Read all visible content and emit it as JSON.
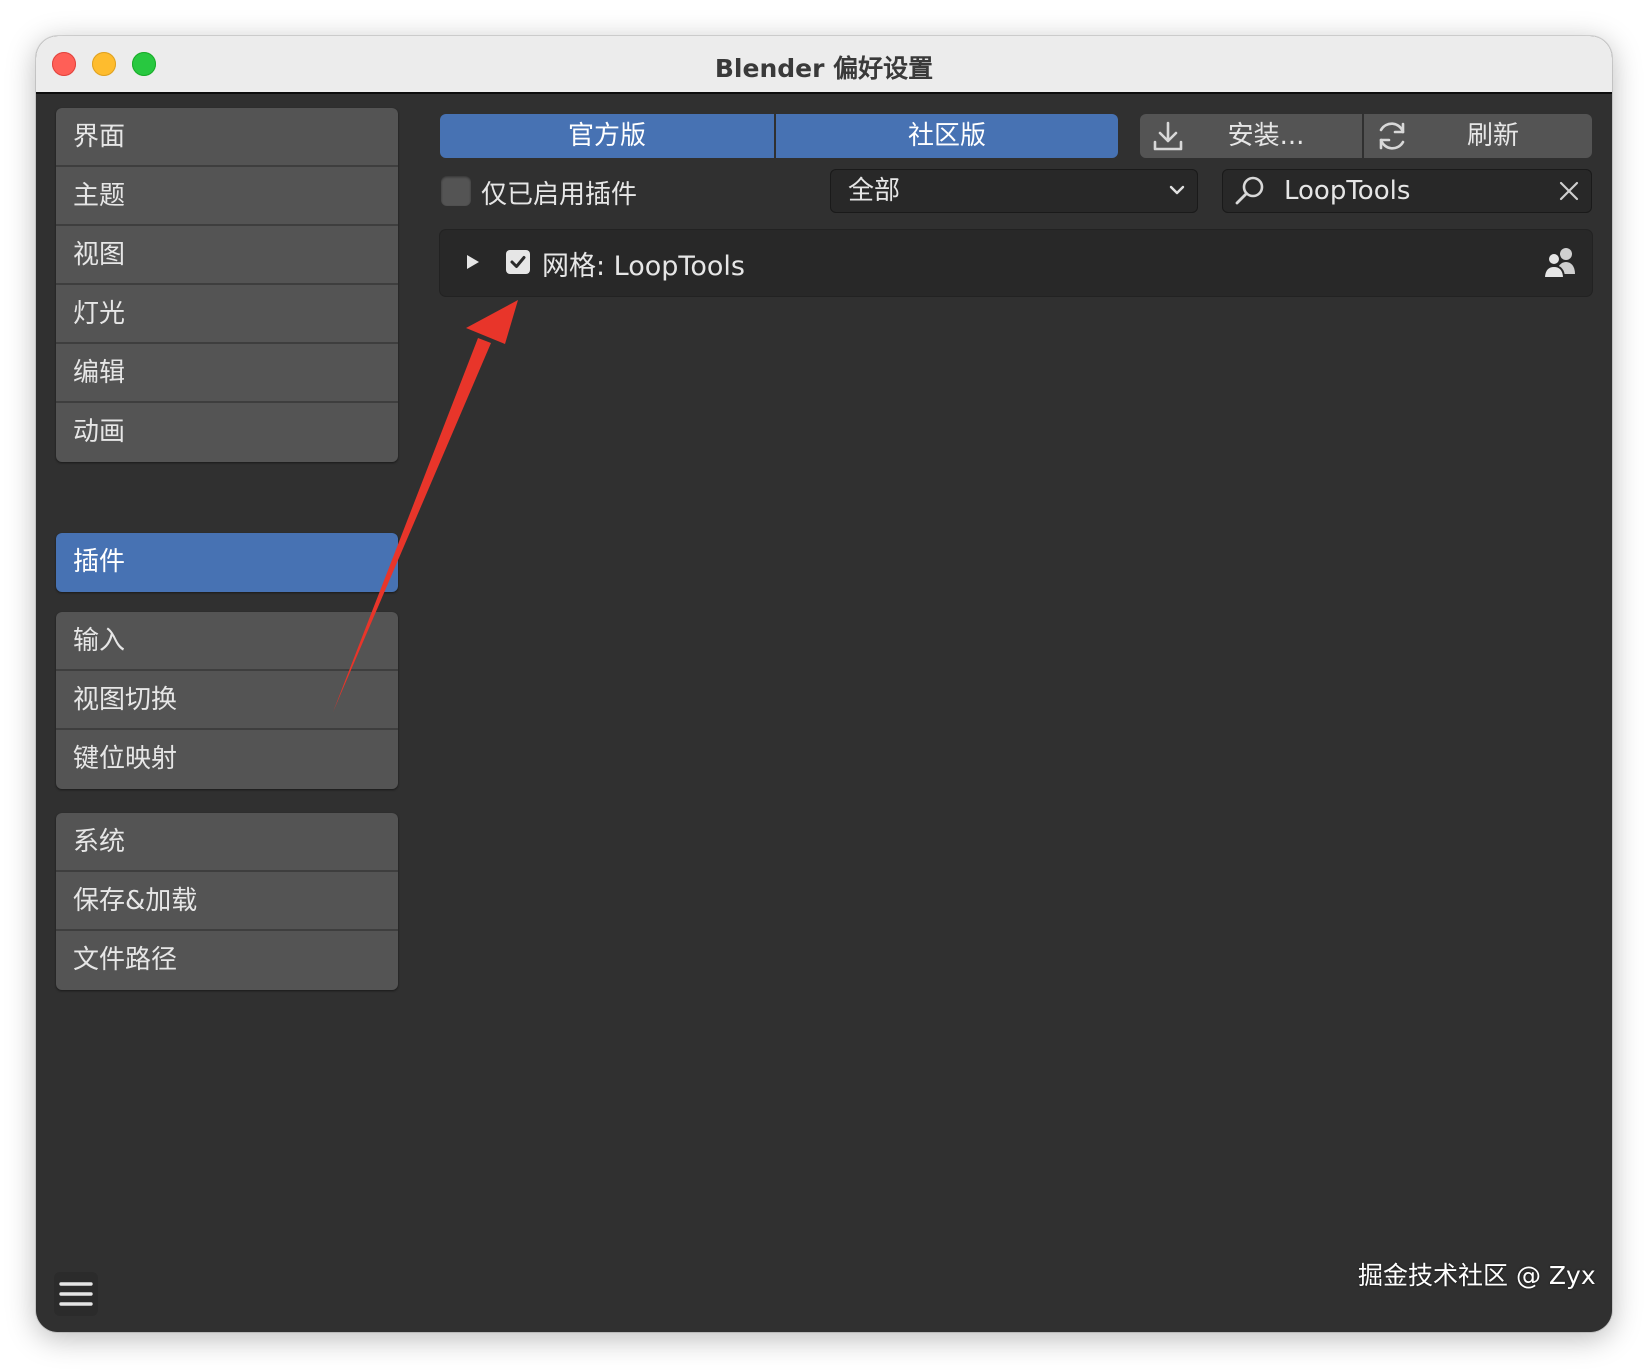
{
  "window": {
    "title": "Blender 偏好设置"
  },
  "sidebar": {
    "groups": [
      {
        "items": [
          {
            "label": "界面"
          },
          {
            "label": "主题"
          },
          {
            "label": "视图"
          },
          {
            "label": "灯光"
          },
          {
            "label": "编辑"
          },
          {
            "label": "动画"
          }
        ]
      },
      {
        "items": [
          {
            "label": "插件",
            "selected": true
          }
        ]
      },
      {
        "items": [
          {
            "label": "输入"
          },
          {
            "label": "视图切换"
          },
          {
            "label": "键位映射"
          }
        ]
      },
      {
        "items": [
          {
            "label": "系统"
          },
          {
            "label": "保存&加载"
          },
          {
            "label": "文件路径"
          }
        ]
      }
    ]
  },
  "tabs": {
    "official": "官方版",
    "community": "社区版"
  },
  "toolbar": {
    "install_label": "安装...",
    "install_icon": "download-icon",
    "refresh_label": "刷新",
    "refresh_icon": "refresh-icon"
  },
  "filters": {
    "enabled_only_label": "仅已启用插件",
    "enabled_only_checked": false,
    "category_value": "全部",
    "search_value": "LoopTools",
    "search_icon": "search-icon",
    "clear_icon": "close-icon"
  },
  "addons": [
    {
      "name": "网格: LoopTools",
      "enabled": true,
      "expanded": false,
      "icon": "community-users-icon"
    }
  ],
  "watermark": "掘金技术社区 @ Zyx",
  "colors": {
    "accent": "#4772b3",
    "background": "#303030",
    "button": "#545454",
    "annotation_arrow": "#e8352a"
  }
}
